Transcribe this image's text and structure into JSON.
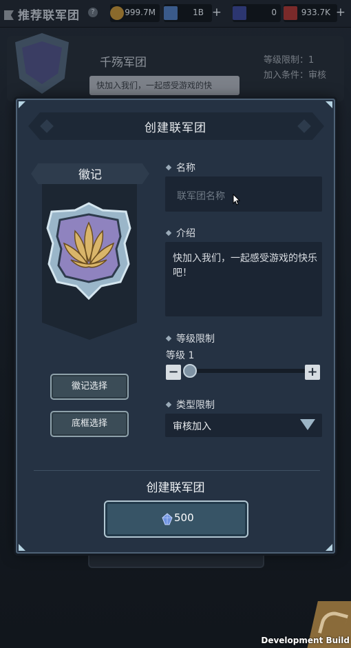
{
  "background": {
    "page_title": "推荐联军团",
    "resources": [
      {
        "icon": "gold-coin-icon",
        "value": "999.7M",
        "plus": false
      },
      {
        "icon": "blue-crystal-icon",
        "value": "1B",
        "plus": true
      },
      {
        "icon": "blue-ticket-icon",
        "value": "0",
        "plus": false
      },
      {
        "icon": "red-ticket-icon",
        "value": "933.7K",
        "plus": false
      }
    ],
    "guild_name": "千殇军团",
    "guild_desc": "快加入我们，一起感受游戏的快",
    "level_limit": "等级限制：1",
    "join_condition": "加入条件：审核",
    "dev_build": "Development Build"
  },
  "modal": {
    "title": "创建联军团",
    "emblem_label": "徽记",
    "emblem_select": "徽记选择",
    "frame_select": "底框选择",
    "name_label": "名称",
    "name_placeholder": "联军团名称",
    "intro_label": "介绍",
    "intro_text": "快加入我们，一起感受游戏的快乐吧！",
    "level_label": "等级限制",
    "level_value": "等级 1",
    "level_fraction": 0.0,
    "type_label": "类型限制",
    "type_value": "审核加入",
    "create_label": "创建联军团",
    "create_cost": "500"
  },
  "colors": {
    "modal_bg": "#253243",
    "field_bg": "#1b2533",
    "accent": "#b2c7d2",
    "emblem_purple": "#8f83bf",
    "lotus_gold": "#d9b56a"
  }
}
